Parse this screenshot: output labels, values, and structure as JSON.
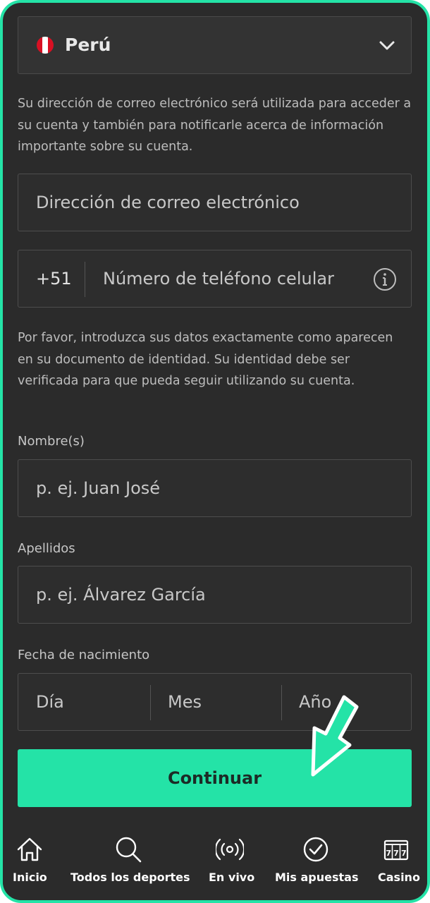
{
  "country": {
    "flag_icon": "peru-flag-icon",
    "name": "Perú",
    "chevron_icon": "chevron-down-icon"
  },
  "email_help_text": "Su dirección de correo electrónico será utilizada para acceder a su cuenta y también para notificarle acerca de información importante sobre su cuenta.",
  "email": {
    "placeholder": "Dirección de correo electrónico"
  },
  "phone": {
    "prefix": "+51",
    "placeholder": "Número de teléfono celular",
    "info_icon": "info-icon"
  },
  "identity_help_text": "Por favor, introduzca sus datos exactamente como aparecen en su documento de identidad. Su identidad debe ser verificada para que pueda seguir utilizando su cuenta.",
  "given_name": {
    "label": "Nombre(s)",
    "placeholder": "p. ej. Juan José"
  },
  "surname": {
    "label": "Apellidos",
    "placeholder": "p. ej. Álvarez García"
  },
  "dob": {
    "label": "Fecha de nacimiento",
    "day": "Día",
    "month": "Mes",
    "year": "Año"
  },
  "continue_label": "Continuar",
  "nav": [
    {
      "label": "Inicio",
      "icon": "home-icon"
    },
    {
      "label": "Todos los deportes",
      "icon": "search-icon"
    },
    {
      "label": "En vivo",
      "icon": "live-broadcast-icon"
    },
    {
      "label": "Mis apuestas",
      "icon": "check-circle-icon"
    },
    {
      "label": "Casino",
      "icon": "slot-machine-icon"
    }
  ],
  "colors": {
    "accent": "#24e3a7",
    "background": "#2b2b2b",
    "field_border": "#4d4d4d"
  }
}
